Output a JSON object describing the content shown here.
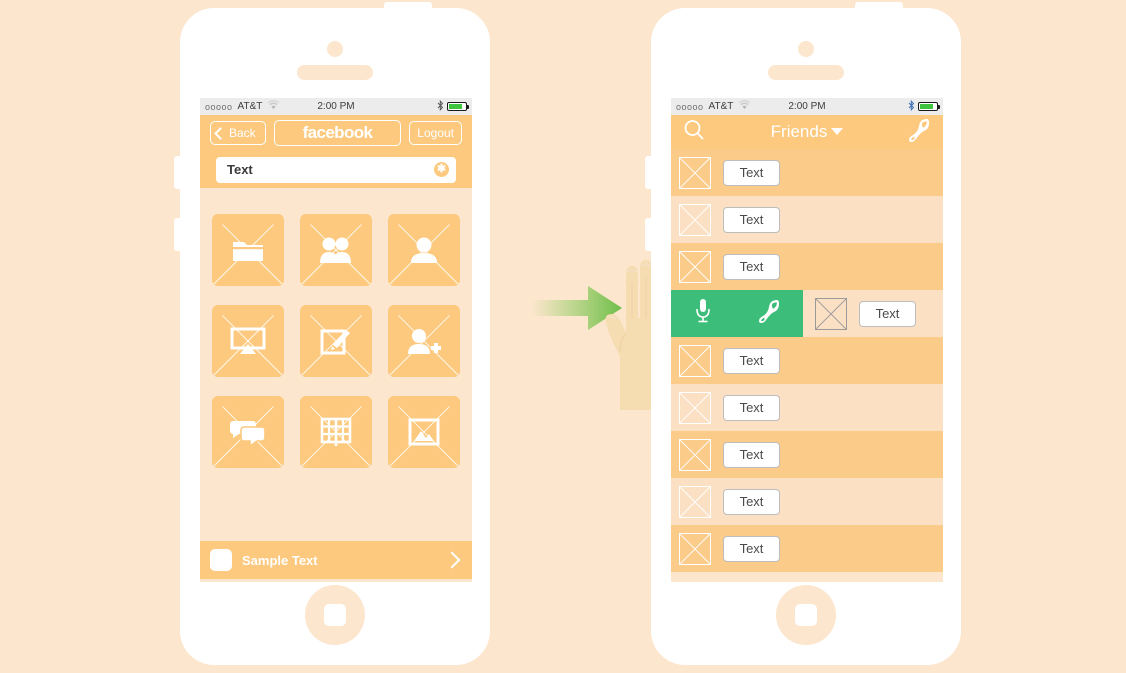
{
  "canvas": {
    "background_color": "#fce6cd",
    "accent_orange": "#fcc97e",
    "row_alt_color": "#fce0c4",
    "action_green": "#3cbd79",
    "battery_green": "#3ec43e"
  },
  "status_bar": {
    "signal_dots": "ooooo",
    "carrier": "AT&T",
    "wifi_icon": "wifi-icon",
    "time": "2:00 PM",
    "bluetooth_icon": "bluetooth-icon",
    "battery_icon": "battery-icon"
  },
  "left_phone": {
    "nav": {
      "back_label": "Back",
      "back_icon": "chevron-left-icon",
      "title": "facebook",
      "logout_label": "Logout"
    },
    "search": {
      "value": "Text",
      "placeholder": "Text",
      "clear_icon": "clear-circle-icon"
    },
    "grid": [
      [
        {
          "icon": "folder-icon"
        },
        {
          "icon": "group-people-icon"
        },
        {
          "icon": "person-icon"
        }
      ],
      [
        {
          "icon": "presentation-screen-icon"
        },
        {
          "icon": "compose-pencil-icon"
        },
        {
          "icon": "add-person-icon"
        }
      ],
      [
        {
          "icon": "chat-bubbles-icon"
        },
        {
          "icon": "open-book-icon"
        },
        {
          "icon": "photo-image-icon"
        }
      ]
    ],
    "bottom_bar": {
      "checkbox_icon": "rounded-square-icon",
      "label": "Sample Text",
      "chevron_icon": "chevron-right-icon"
    }
  },
  "right_phone": {
    "nav": {
      "search_icon": "search-icon",
      "title": "Friends",
      "caret_icon": "caret-down-icon",
      "call_icon": "phone-handset-icon"
    },
    "rows": [
      {
        "thumb_icon": "placeholder-image-icon",
        "label": "Text",
        "type": "normal"
      },
      {
        "thumb_icon": "placeholder-image-icon",
        "label": "Text",
        "type": "normal"
      },
      {
        "thumb_icon": "placeholder-image-icon",
        "label": "Text",
        "type": "normal"
      },
      {
        "type": "swipe-action",
        "actions": [
          {
            "icon": "microphone-icon"
          },
          {
            "icon": "phone-handset-icon"
          }
        ],
        "thumb_icon": "placeholder-image-icon",
        "label": "Text"
      },
      {
        "thumb_icon": "placeholder-image-icon",
        "label": "Text",
        "type": "normal"
      },
      {
        "thumb_icon": "placeholder-image-icon",
        "label": "Text",
        "type": "normal"
      },
      {
        "thumb_icon": "placeholder-image-icon",
        "label": "Text",
        "type": "normal"
      },
      {
        "thumb_icon": "placeholder-image-icon",
        "label": "Text",
        "type": "normal"
      },
      {
        "thumb_icon": "placeholder-image-icon",
        "label": "Text",
        "type": "normal"
      }
    ]
  },
  "gesture": {
    "arrow_icon": "right-arrow-icon",
    "hand_icon": "swipe-hand-icon",
    "arrow_color": "#7ac943",
    "hand_color": "#f5dcb0"
  }
}
